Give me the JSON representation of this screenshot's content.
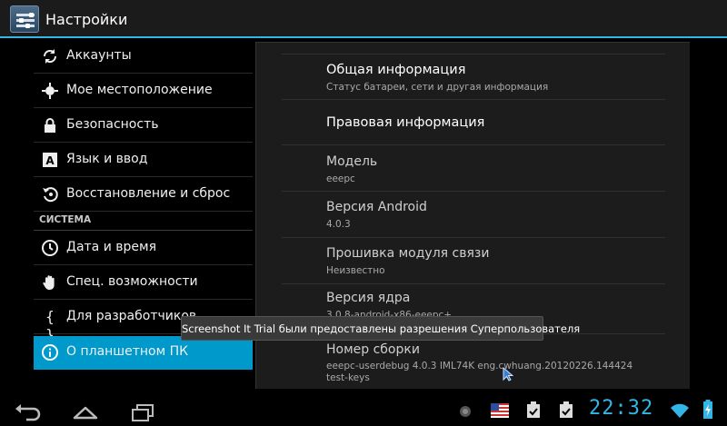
{
  "app": {
    "title": "Настройки"
  },
  "sidebar": {
    "items": [
      {
        "label": "Аккаунты",
        "icon": "sync-icon"
      },
      {
        "label": "Мое местоположение",
        "icon": "location-icon"
      },
      {
        "label": "Безопасность",
        "icon": "lock-icon"
      },
      {
        "label": "Язык и ввод",
        "icon": "keyboard-letter-icon"
      },
      {
        "label": "Восстановление и сброс",
        "icon": "restore-icon"
      }
    ],
    "section_header": "СИСТЕМА",
    "system_items": [
      {
        "label": "Дата и время",
        "icon": "clock-icon"
      },
      {
        "label": "Спец. возможности",
        "icon": "hand-icon"
      },
      {
        "label": "Для разработчиков",
        "icon": "braces-icon"
      },
      {
        "label": "О планшетном ПК",
        "icon": "info-icon",
        "selected": true
      }
    ]
  },
  "about": {
    "items": [
      {
        "title": "Общая информация",
        "subtitle": "Статус батареи, сети и другая информация"
      },
      {
        "title": "Правовая информация"
      },
      {
        "title": "Модель",
        "subtitle": "eeepc"
      },
      {
        "title": "Версия Android",
        "subtitle": "4.0.3"
      },
      {
        "title": "Прошивка модуля связи",
        "subtitle": "Неизвестно"
      },
      {
        "title": "Версия ядра",
        "subtitle": "3.0.8-android-x86-eeepc+"
      },
      {
        "title": "Номер сборки",
        "subtitle": "eeepc-userdebug 4.0.3 IML74K eng.cwhuang.20120226.144424 test-keys"
      }
    ]
  },
  "toast": {
    "text": "Screenshot It Trial были предоставлены разрешения Суперпользователя"
  },
  "statusbar": {
    "time": "22:32"
  },
  "colors": {
    "accent": "#33b5e5",
    "selected": "#0099cc",
    "panel": "#1c1c1c"
  }
}
